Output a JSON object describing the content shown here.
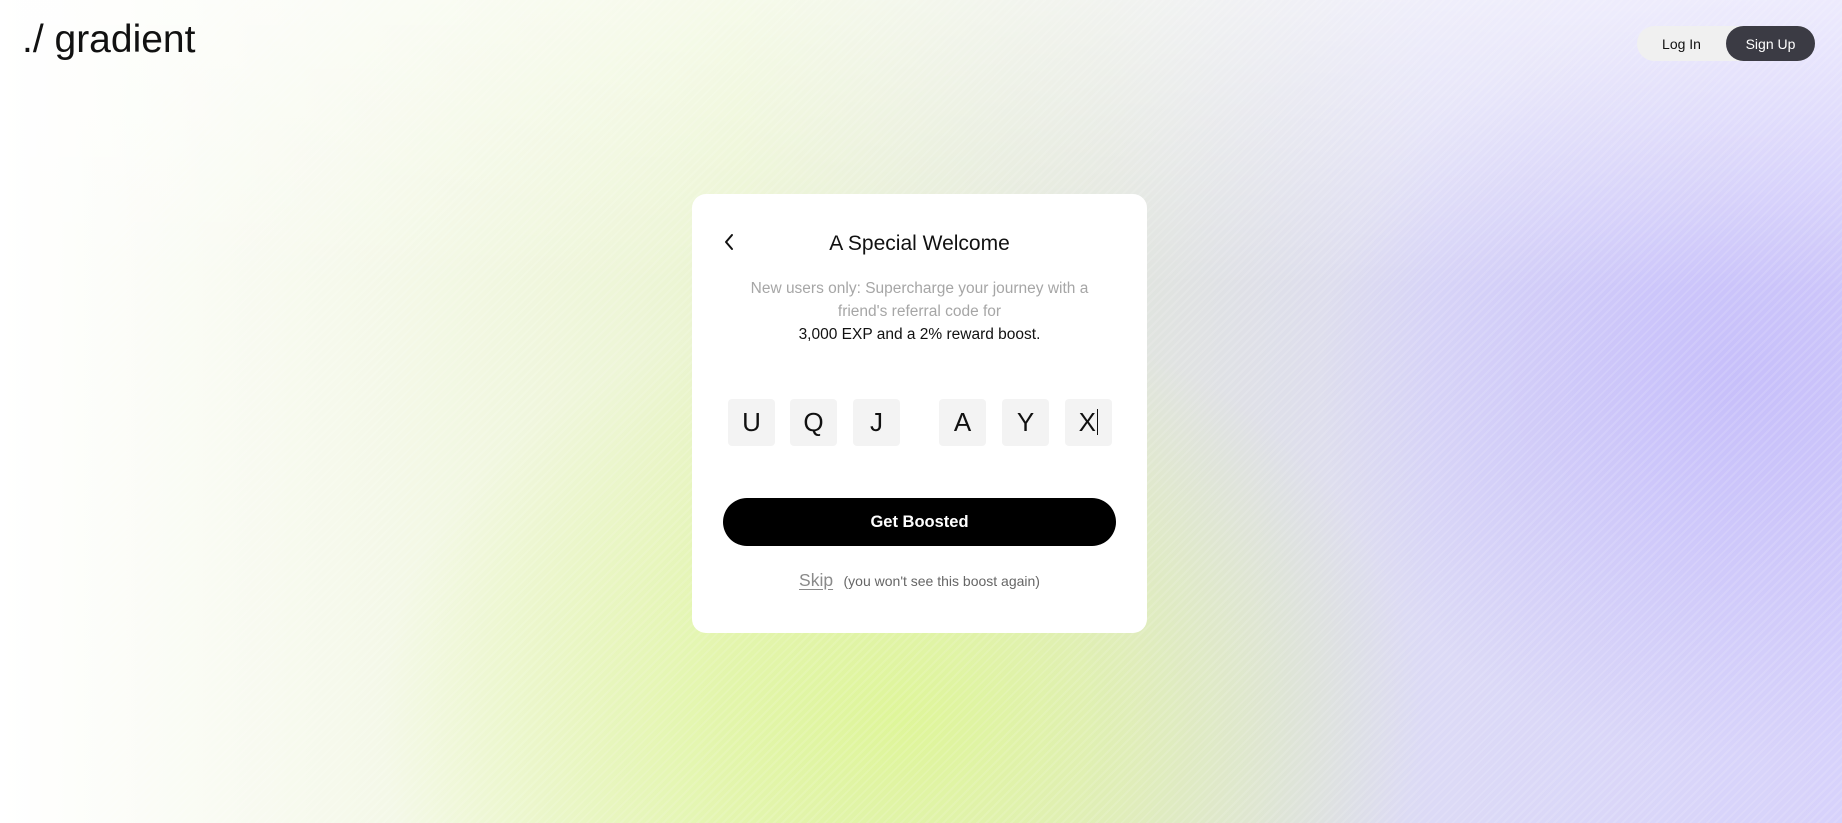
{
  "brand": {
    "logo_text": "./ gradient"
  },
  "header": {
    "login_label": "Log In",
    "signup_label": "Sign Up",
    "active_tab": "Sign Up"
  },
  "card": {
    "title": "A Special Welcome",
    "description": "New users only: Supercharge your journey with a friend's referral code for",
    "highlight": "3,000 EXP and a 2% reward boost.",
    "referral_code": [
      "U",
      "Q",
      "J",
      "A",
      "Y",
      "X"
    ],
    "submit_label": "Get Boosted",
    "skip_label": "Skip",
    "skip_note": "(you won't see this boost again)"
  },
  "icons": {
    "back": "chevron-left-icon"
  },
  "colors": {
    "primary_button": "#000000",
    "active_toggle": "#3b3b44",
    "code_box_bg": "#f3f3f3",
    "muted_text": "#a6a6a6"
  }
}
